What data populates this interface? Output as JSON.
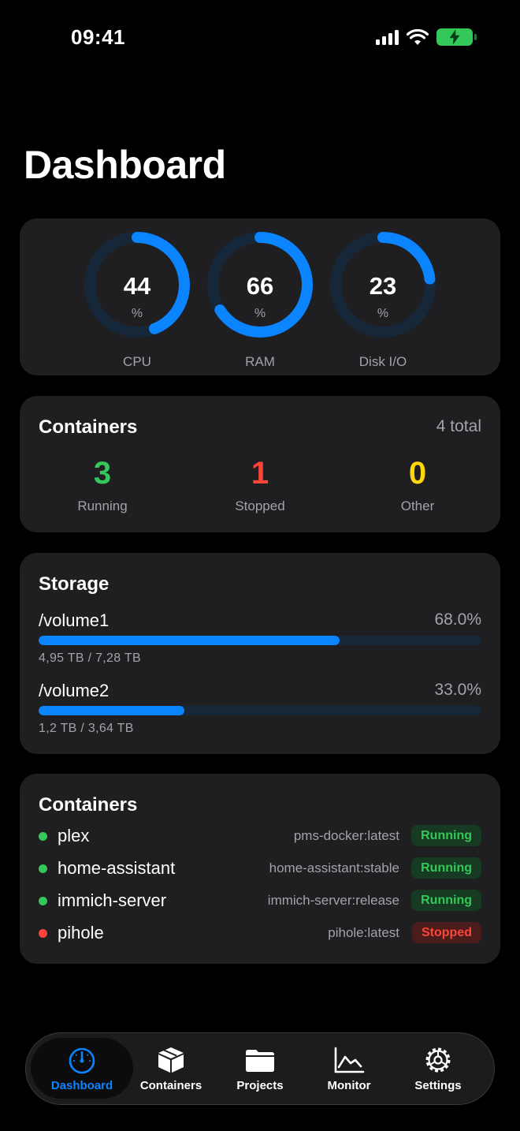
{
  "status_bar": {
    "time": "09:41",
    "icons": [
      "signal-icon",
      "wifi-icon",
      "battery-charging-icon"
    ]
  },
  "page": {
    "title": "Dashboard"
  },
  "gauges": [
    {
      "value": "44",
      "unit": "%",
      "label": "CPU",
      "percent": 44
    },
    {
      "value": "66",
      "unit": "%",
      "label": "RAM",
      "percent": 66
    },
    {
      "value": "23",
      "unit": "%",
      "label": "Disk I/O",
      "percent": 23
    }
  ],
  "summary": {
    "title": "Containers",
    "total": "4 total",
    "stats": [
      {
        "value": "3",
        "label": "Running",
        "color": "#34c759"
      },
      {
        "value": "1",
        "label": "Stopped",
        "color": "#ff453a"
      },
      {
        "value": "0",
        "label": "Other",
        "color": "#ffd60a"
      }
    ]
  },
  "storage": {
    "title": "Storage",
    "volumes": [
      {
        "name": "/volume1",
        "percent_label": "68.0%",
        "percent": 68,
        "size": "4,95 TB / 7,28 TB"
      },
      {
        "name": "/volume2",
        "percent_label": "33.0%",
        "percent": 33,
        "size": "1,2 TB / 3,64 TB"
      }
    ]
  },
  "container_list": {
    "title": "Containers",
    "items": [
      {
        "name": "plex",
        "image": "pms-docker:latest",
        "status": "Running"
      },
      {
        "name": "home-assistant",
        "image": "home-assistant:stable",
        "status": "Running"
      },
      {
        "name": "immich-server",
        "image": "immich-server:release",
        "status": "Running"
      },
      {
        "name": "pihole",
        "image": "pihole:latest",
        "status": "Stopped"
      }
    ]
  },
  "tabs": [
    {
      "label": "Dashboard",
      "icon": "gauge-icon",
      "active": true
    },
    {
      "label": "Containers",
      "icon": "cube-icon",
      "active": false
    },
    {
      "label": "Projects",
      "icon": "folder-icon",
      "active": false
    },
    {
      "label": "Monitor",
      "icon": "chart-line-icon",
      "active": false
    },
    {
      "label": "Settings",
      "icon": "gear-icon",
      "active": false
    }
  ],
  "colors": {
    "accent": "#0a84ff",
    "running": "#34c759",
    "stopped": "#ff453a",
    "other": "#ffd60a",
    "card": "#1f1f21"
  }
}
